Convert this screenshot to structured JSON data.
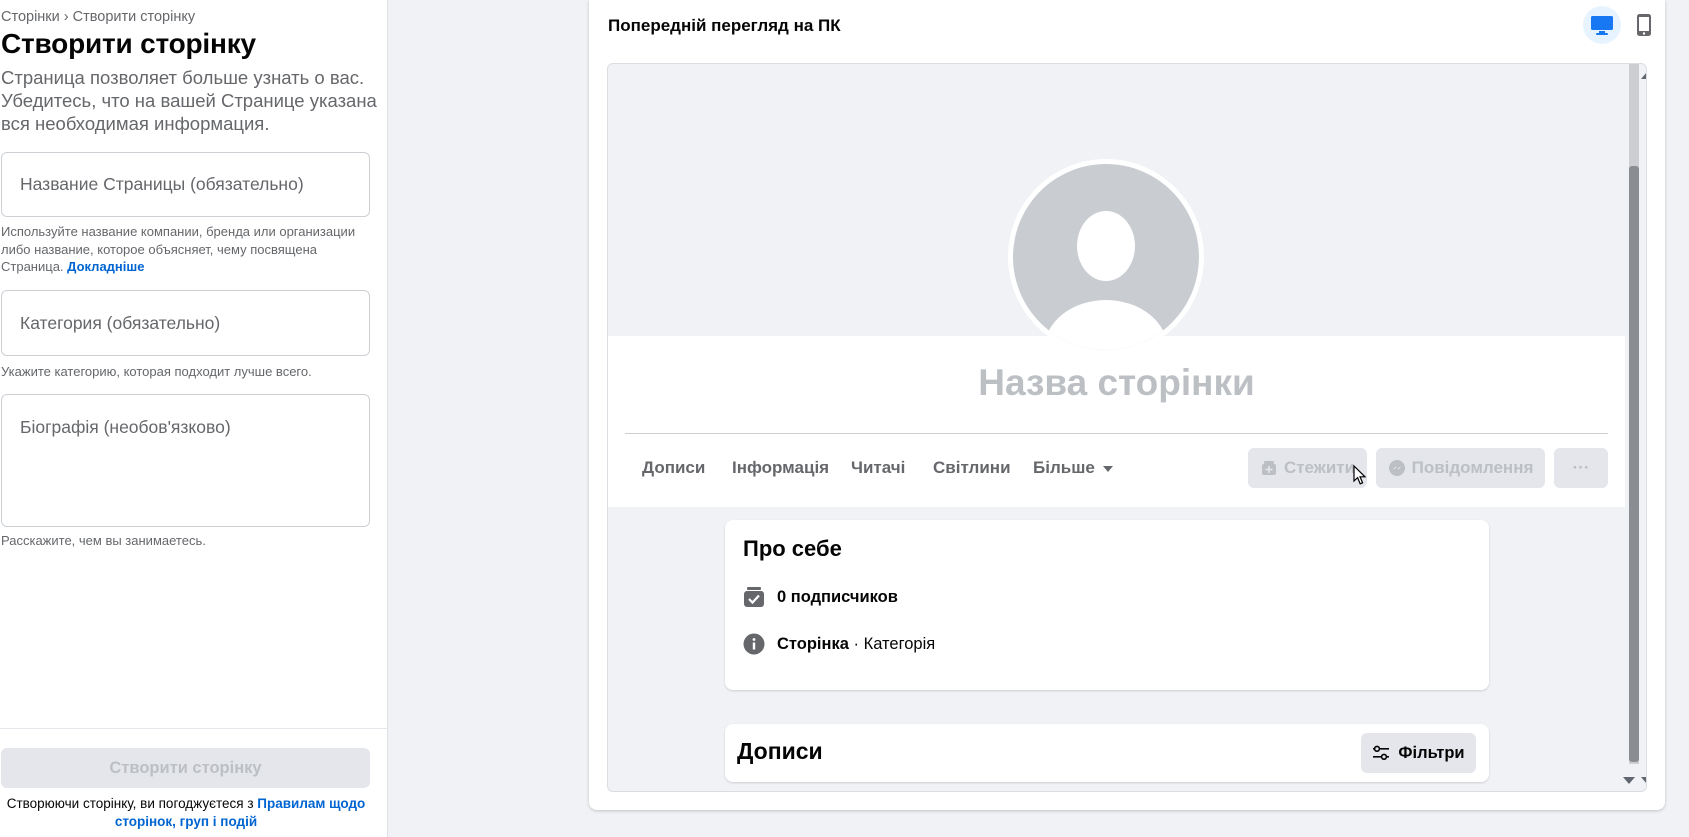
{
  "breadcrumb": {
    "root": "Сторінки",
    "separator": "›",
    "current": "Створити сторінку"
  },
  "sidebar": {
    "title": "Створити сторінку",
    "intro": "Страница позволяет больше узнать о вас. Убедитесь, что на вашей Странице указана вся необходимая информация.",
    "name_field": {
      "placeholder": "Название Страницы (обязательно)",
      "value": ""
    },
    "name_help": "Используйте название компании, бренда или организации либо название, которое объясняет, чему посвящена Страница.",
    "name_help_link": "Докладніше",
    "category_field": {
      "placeholder": "Категория (обязательно)",
      "value": ""
    },
    "category_help": "Укажите категорию, которая подходит лучше всего.",
    "bio_field": {
      "placeholder": "Біографія (необов'язково)",
      "value": ""
    },
    "bio_help": "Расскажите, чем вы занимаетесь.",
    "create_button": "Створити сторінку",
    "legal_text": "Створюючи сторінку, ви погоджуєтеся з",
    "legal_link": "Правилам щодо сторінок, груп і подій"
  },
  "preview": {
    "title": "Попередній перегляд на ПК",
    "device_buttons": [
      {
        "icon": "desktop-icon",
        "active": true
      },
      {
        "icon": "mobile-icon",
        "active": false
      }
    ],
    "page_name_placeholder": "Назва сторінки",
    "tabs": [
      "Дописи",
      "Інформація",
      "Читачі",
      "Світлини",
      "Більше"
    ],
    "actions": {
      "follow": "Стежити",
      "message": "Повідомлення",
      "more": "···"
    },
    "about": {
      "title": "Про себе",
      "followers": "0 подписчиков",
      "type_label": "Сторінка",
      "separator": " · ",
      "category_label": "Категорія"
    },
    "posts": {
      "title": "Дописи",
      "filters": "Фільтри"
    }
  },
  "colors": {
    "link": "#0064d1",
    "accent_light": "#e7f3ff",
    "accent": "#1877f2",
    "disabled_text": "#bcc0c4",
    "button_bg": "#e4e6eb"
  }
}
